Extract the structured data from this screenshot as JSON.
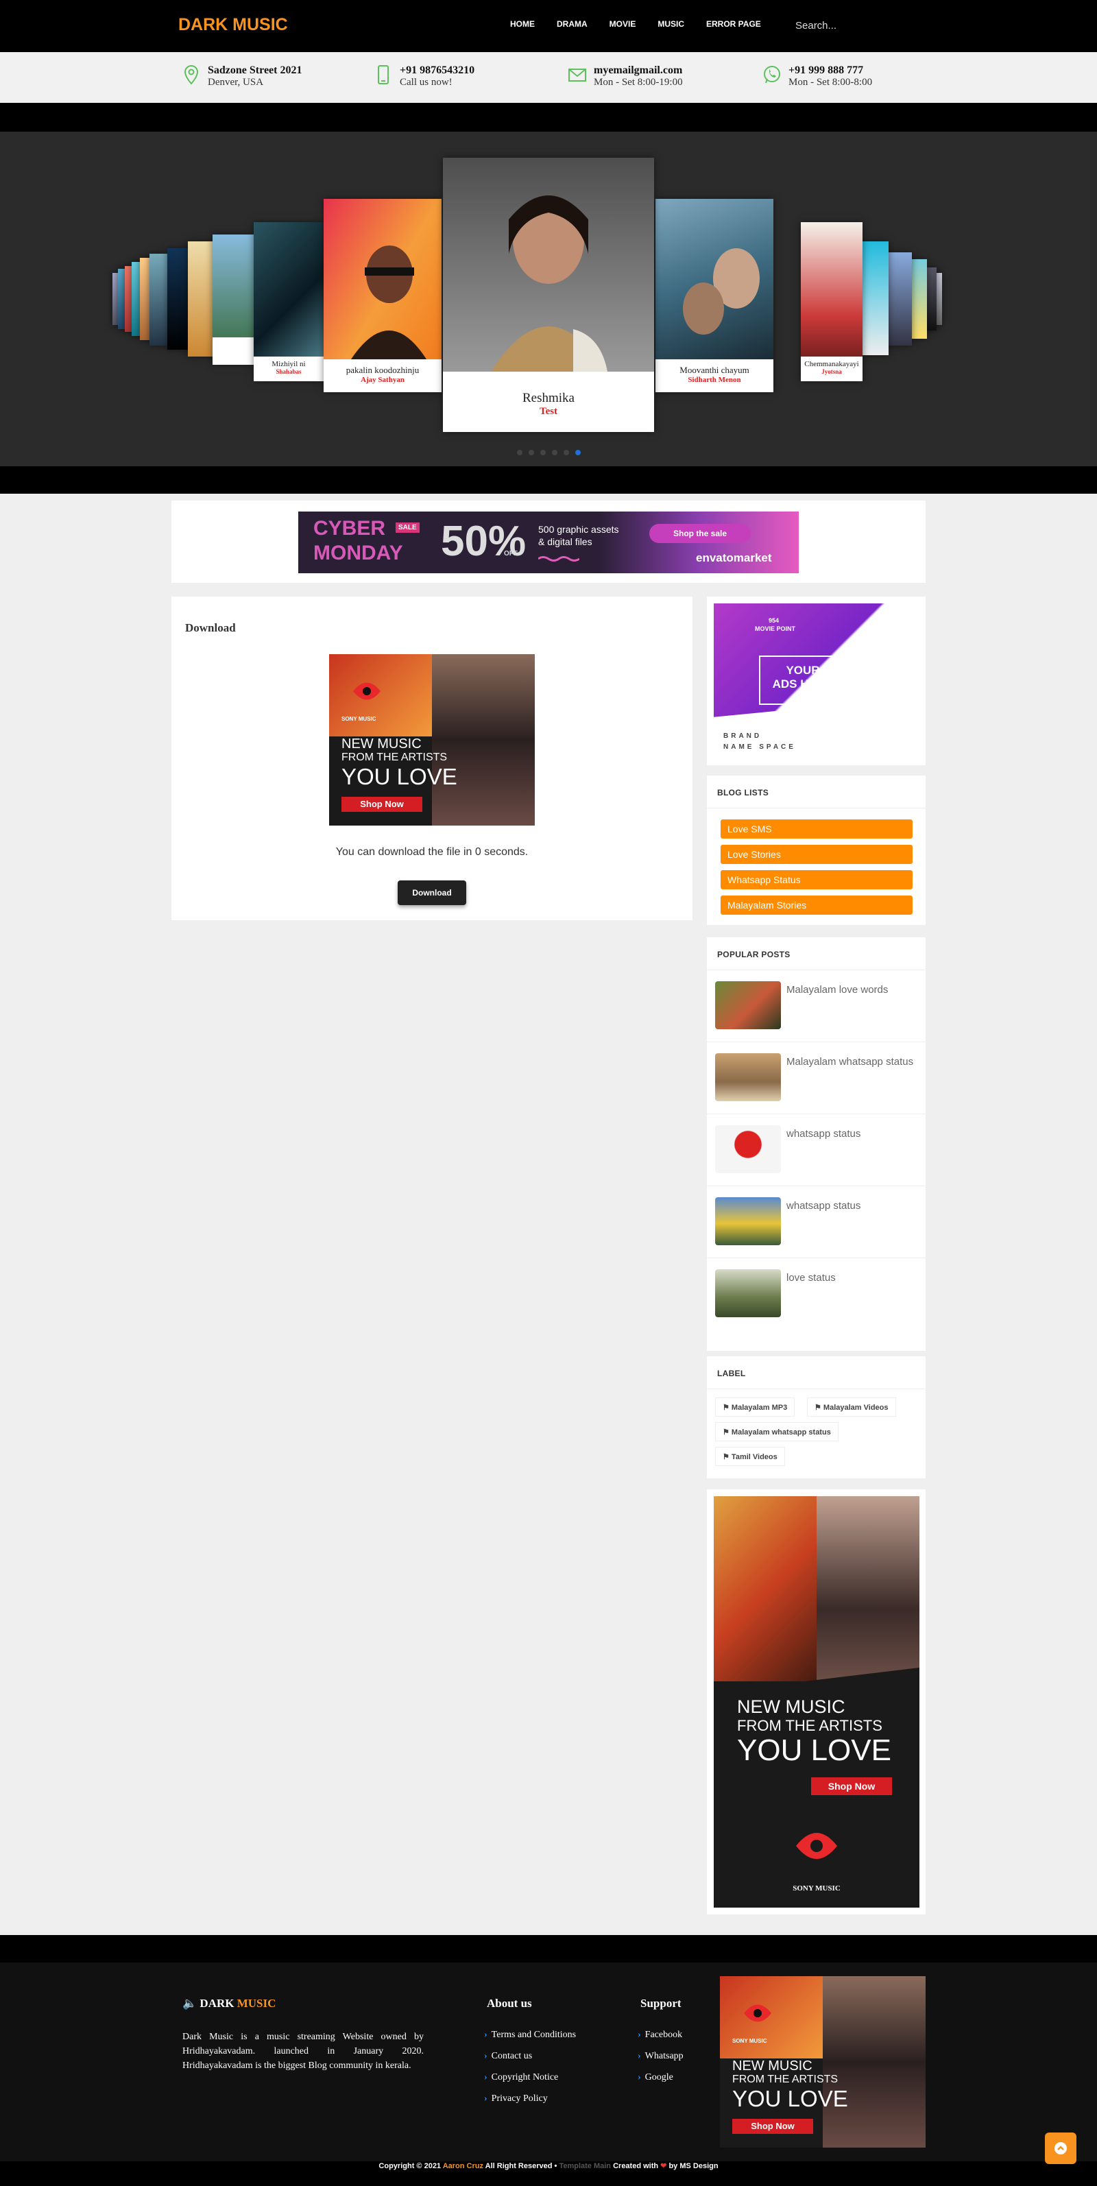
{
  "header": {
    "logo": "DARK MUSIC",
    "nav": [
      "HOME",
      "DRAMA",
      "MOVIE",
      "MUSIC",
      "ERROR PAGE"
    ],
    "search_placeholder": "Search..."
  },
  "infobar": [
    {
      "icon": "map-pin-icon",
      "line1": "Sadzone Street 2021",
      "line2": "Denver, USA"
    },
    {
      "icon": "phone-icon",
      "line1": "+91 9876543210",
      "line2": "Call us now!"
    },
    {
      "icon": "mail-icon",
      "line1": "myemailgmail.com",
      "line2": "Mon - Set 8:00-19:00"
    },
    {
      "icon": "whatsapp-icon",
      "line1": "+91 999 888 777",
      "line2": "Mon - Set 8:00-8:00"
    }
  ],
  "slider": {
    "center": {
      "title": "Reshmika",
      "subtitle": "Test"
    },
    "left1": {
      "title": "pakalin koodozhinju",
      "subtitle": "Ajay Sathyan"
    },
    "left2": {
      "title": "Mizhiyil ni",
      "subtitle": "Shahabas"
    },
    "right1": {
      "title": "Moovanthi chayum",
      "subtitle": "Sidharth Menon"
    },
    "right2": {
      "title": "Chemmanakayayi",
      "subtitle": "Jyotsna"
    },
    "dots": 7,
    "active_dot": 6
  },
  "top_ad": {
    "word1": "CYBER",
    "badge": "SALE",
    "word2": "MONDAY",
    "percent": "50%",
    "off": "OFF",
    "text1": "500 graphic assets",
    "text2": "& digital files",
    "button": "Shop the sale",
    "brand": "envatomarket"
  },
  "main": {
    "title": "Download",
    "ad": {
      "brand": "SONY MUSIC",
      "line1": "NEW MUSIC",
      "line2": "FROM THE ARTISTS",
      "line3": "YOU LOVE",
      "button": "Shop Now"
    },
    "countdown_text": "You can download the file in 0 seconds.",
    "button": "Download"
  },
  "sidebar": {
    "ad1": {
      "small1": "954",
      "small2": "MOVIE POINT",
      "text1": "YOUR",
      "text2": "ADS HEAR",
      "brand1": "BRAND",
      "brand2": "NAME SPACE"
    },
    "blog_lists": {
      "title": "BLOG LISTS",
      "items": [
        "Love SMS",
        "Love Stories",
        "Whatsapp Status",
        "Malayalam Stories"
      ]
    },
    "popular_posts": {
      "title": "POPULAR POSTS",
      "items": [
        "Malayalam love words",
        "Malayalam whatsapp status",
        "whatsapp status",
        "whatsapp status",
        "love status"
      ]
    },
    "label": {
      "title": "LABEL",
      "tags": [
        "Malayalam MP3",
        "Malayalam Videos",
        "Malayalam whatsapp status",
        "Tamil Videos"
      ]
    },
    "ad2": {
      "line1": "NEW MUSIC",
      "line2": "FROM THE ARTISTS",
      "line3": "YOU LOVE",
      "button": "Shop Now",
      "brand": "SONY MUSIC"
    }
  },
  "footer": {
    "logo_part1": "DARK",
    "logo_part2": "MUSIC",
    "about_text": "Dark Music is a music streaming Website owned by Hridhayakavadam. launched in January 2020. Hridhayakavadam is the biggest Blog community in kerala.",
    "about_title": "About us",
    "about_links": [
      "Terms and Conditions",
      "Contact us",
      "Copyright Notice",
      "Privacy Policy"
    ],
    "support_title": "Support",
    "support_links": [
      "Facebook",
      "Whatsapp",
      "Google"
    ],
    "ad": {
      "brand": "SONY MUSIC",
      "line1": "NEW MUSIC",
      "line2": "FROM THE ARTISTS",
      "line3": "YOU LOVE",
      "button": "Shop Now"
    },
    "copy_a": "Copyright © 2021",
    "copy_name": "Aaron Cruz",
    "copy_b": "All Right Reserved •",
    "copy_tm": "Template Main",
    "copy_c": "Created with",
    "copy_d": "by MS Design"
  },
  "colors": {
    "accent": "#f7931e",
    "orange_button": "#ff8c00",
    "dark": "#000000",
    "link_chevron": "#1e90ff"
  }
}
